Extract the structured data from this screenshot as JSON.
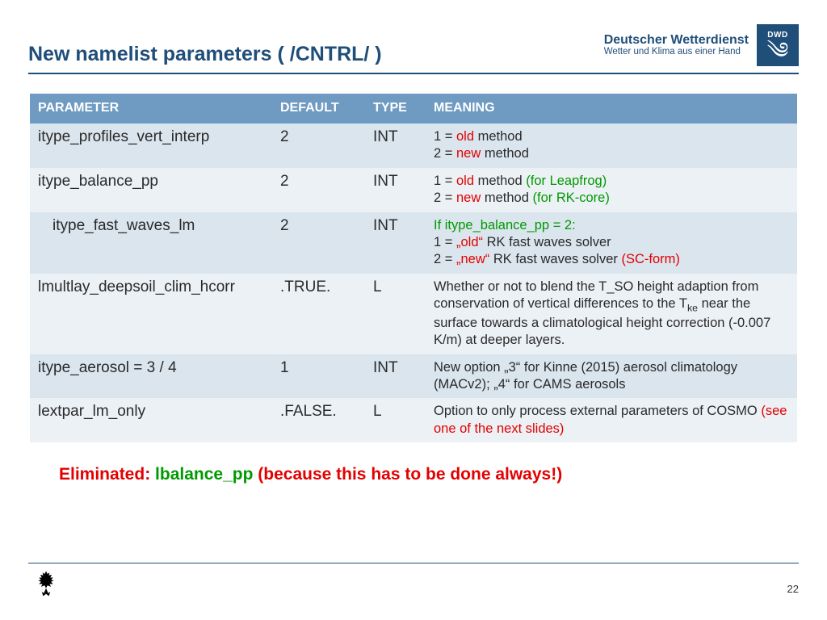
{
  "header": {
    "title": "New namelist parameters ( /CNTRL/ )",
    "brand_main": "Deutscher Wetterdienst",
    "brand_sub": "Wetter und Klima aus einer Hand",
    "logo_text": "DWD"
  },
  "table": {
    "cols": [
      "PARAMETER",
      "DEFAULT",
      "TYPE",
      "MEANING"
    ],
    "rows": [
      {
        "param": "itype_profiles_vert_interp",
        "default": "2",
        "type": "INT",
        "meaning_html": "1 = <span class='red'>old</span> method<br>2 = <span class='red'>new</span> method"
      },
      {
        "param": "itype_balance_pp",
        "default": "2",
        "type": "INT",
        "meaning_html": "1 = <span class='red'>old</span> method <span class='green'>(for Leapfrog)</span><br>2 = <span class='red'>new</span> method <span class='green'>(for RK-core)</span>"
      },
      {
        "param_html": "<span class='indent'>itype_fast_waves_lm</span>",
        "default": "2",
        "type": "INT",
        "meaning_html": "<span class='green'>If itype_balance_pp = 2:</span><br>1 = <span class='red'>„old“</span> RK fast waves solver<br>2 = <span class='red'>„new“</span> RK fast waves solver <span class='red'>(SC-form)</span>"
      },
      {
        "param": "lmultlay_deepsoil_clim_hcorr",
        "default": ".TRUE.",
        "type": "L",
        "meaning_html": "Whether or not to blend the T_SO height adaption from conservation of vertical differences to the T<sub>ke</sub> near the surface towards a climatological height correction (-0.007 K/m) at deeper layers."
      },
      {
        "param": "itype_aerosol = 3 / 4",
        "default": "1",
        "type": "INT",
        "meaning_html": "New option „3“ for Kinne (2015) aerosol climatology (MACv2); „4“ for CAMS aerosols"
      },
      {
        "param": "lextpar_lm_only",
        "default": ".FALSE.",
        "type": "L",
        "meaning_html": "Option to only process external parameters of COSMO <span class='red'>(see one of the next slides)</span>"
      }
    ]
  },
  "eliminated": {
    "label": "Eliminated:",
    "name": "lbalance_pp",
    "reason": "(because this has to be done always!)"
  },
  "footer": {
    "page": "22"
  }
}
